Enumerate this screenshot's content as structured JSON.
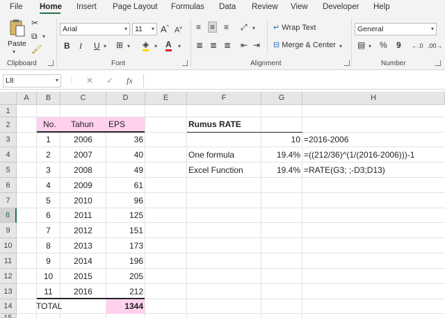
{
  "tabs": [
    "File",
    "Home",
    "Insert",
    "Page Layout",
    "Formulas",
    "Data",
    "Review",
    "View",
    "Developer",
    "Help"
  ],
  "ribbon": {
    "clipboard": {
      "paste_label": "Paste",
      "group_label": "Clipboard"
    },
    "font": {
      "font_name": "Arial",
      "font_size": "11",
      "bold": "B",
      "italic": "I",
      "underline": "U",
      "font_color_glyph": "A",
      "group_label": "Font"
    },
    "alignment": {
      "wrap_text": "Wrap Text",
      "merge_center": "Merge & Center",
      "group_label": "Alignment"
    },
    "number": {
      "format": "General",
      "percent": "%",
      "comma": "9",
      "group_label": "Number"
    }
  },
  "formula_bar": {
    "name_box": "L8",
    "fx": "fx",
    "content": ""
  },
  "columns": [
    "A",
    "B",
    "C",
    "D",
    "E",
    "F",
    "G",
    "H"
  ],
  "rows": [
    "1",
    "2",
    "3",
    "4",
    "5",
    "6",
    "7",
    "8",
    "9",
    "10",
    "11",
    "12",
    "13",
    "14",
    "15"
  ],
  "table": {
    "headers": [
      "No.",
      "Tahun",
      "EPS"
    ],
    "rows": [
      [
        "1",
        "2006",
        "36"
      ],
      [
        "2",
        "2007",
        "40"
      ],
      [
        "3",
        "2008",
        "49"
      ],
      [
        "4",
        "2009",
        "61"
      ],
      [
        "5",
        "2010",
        "96"
      ],
      [
        "6",
        "2011",
        "125"
      ],
      [
        "7",
        "2012",
        "151"
      ],
      [
        "8",
        "2013",
        "173"
      ],
      [
        "9",
        "2014",
        "196"
      ],
      [
        "10",
        "2015",
        "205"
      ],
      [
        "11",
        "2016",
        "212"
      ]
    ],
    "total_label": "TOTAL",
    "total_value": "1344"
  },
  "rate_section": {
    "title": "Rumus RATE",
    "g3": "10",
    "h3": "=2016-2006",
    "f4": "One formula",
    "g4": "19.4%",
    "h4": "=((212/36)^(1/(2016-2006)))-1",
    "f5": "Excel Function",
    "g5": "19.4%",
    "h5": "=RATE(G3; ;-D3;D13)"
  },
  "colors": {
    "accent": "#217346",
    "pink": "#ffd1ee",
    "header_bg": "#e6e6e6"
  }
}
